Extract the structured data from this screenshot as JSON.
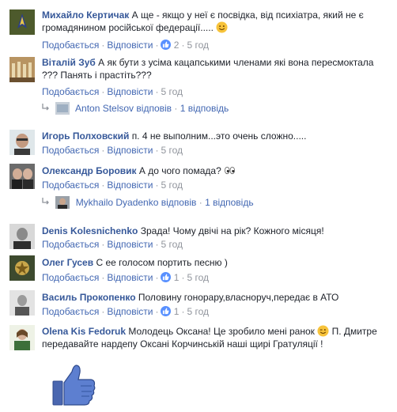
{
  "comments": [
    {
      "author": "Михайло Кертичак",
      "text": "А ще - якщо у неї є посвідка, від психіатра, який не є громадянином російської федерації.....",
      "emoji": "smile",
      "like_label": "Подобається",
      "reply_label": "Відповісти",
      "reactions": "2",
      "time": "5 год"
    },
    {
      "author": "Віталій Зуб",
      "text": "А як бути з усіма кацапськими членами які вона пересмоктала ??? Панять і прастіть???",
      "like_label": "Подобається",
      "reply_label": "Відповісти",
      "time": "5 год",
      "replies": {
        "who": "Anton Stelsov",
        "verb": "відповів",
        "count": "1 відповідь"
      }
    },
    {
      "author": "Игорь Полховский",
      "text": "п. 4 не выполним...это очень сложно.....",
      "like_label": "Подобається",
      "reply_label": "Відповісти",
      "time": "5 год"
    },
    {
      "author": "Олександр Боровик",
      "text": "А до чого помада?",
      "emoji": "eyes",
      "like_label": "Подобається",
      "reply_label": "Відповісти",
      "time": "5 год",
      "replies": {
        "who": "Mykhailo Dyadenko",
        "verb": "відповів",
        "count": "1 відповідь"
      }
    },
    {
      "author": "Denis Kolesnichenko",
      "text": "Зрада! Чому двічі на рік? Кожного місяця!",
      "like_label": "Подобається",
      "reply_label": "Відповісти",
      "time": "5 год"
    },
    {
      "author": "Олег Гусев",
      "text": "С ее голосом портить песню )",
      "like_label": "Подобається",
      "reply_label": "Відповісти",
      "reactions": "1",
      "time": "5 год"
    },
    {
      "author": "Василь Прокопенко",
      "text": "Половину гонорару,власноруч,передає в АТО",
      "like_label": "Подобається",
      "reply_label": "Відповісти",
      "reactions": "1",
      "time": "5 год"
    },
    {
      "author": "Olena Kis Fedoruk",
      "text": "Молодець Оксана! Це зробило мені ранок",
      "text2": "П. Дмитре передавайте нардепу Оксані Корчинській наші щирі Гратуляції !",
      "emoji": "wink"
    }
  ],
  "colors": {
    "link": "#365899",
    "meta": "#90949c",
    "like_blue": "#5890ff"
  }
}
